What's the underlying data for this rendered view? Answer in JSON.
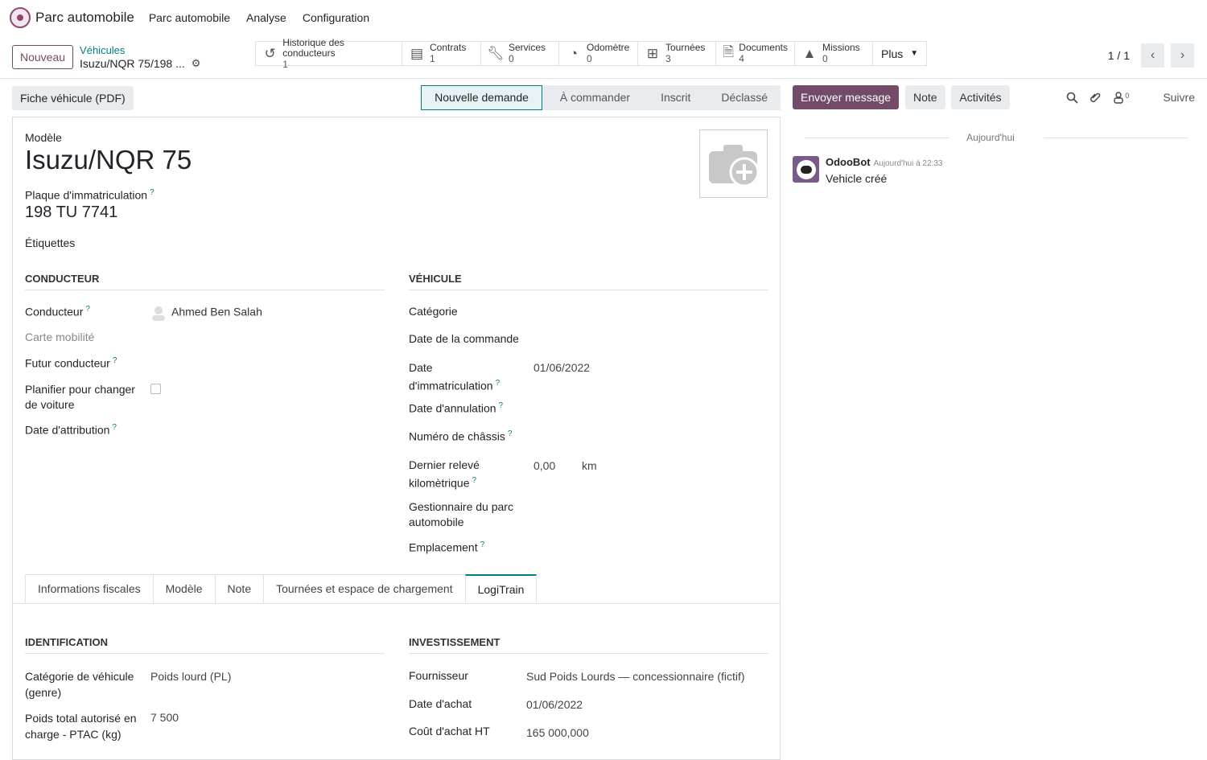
{
  "topnav": {
    "app_name": "Parc automobile",
    "menu": [
      "Parc automobile",
      "Analyse",
      "Configuration"
    ]
  },
  "control": {
    "new_label": "Nouveau",
    "breadcrumb_parent": "Véhicules",
    "breadcrumb_current": "Isuzu/NQR 75/198 ...",
    "smart_buttons": [
      {
        "label": "Historique des conducteurs",
        "count": "1",
        "icon": "history-icon"
      },
      {
        "label": "Contrats",
        "count": "1",
        "icon": "book-icon"
      },
      {
        "label": "Services",
        "count": "0",
        "icon": "wrench-icon"
      },
      {
        "label": "Odomètre",
        "count": "0",
        "icon": "tachometer-icon"
      },
      {
        "label": "Tournées",
        "count": "3",
        "icon": "map-icon"
      },
      {
        "label": "Documents",
        "count": "4",
        "icon": "document-icon"
      },
      {
        "label": "Missions",
        "count": "0",
        "icon": "road-icon"
      }
    ],
    "more_label": "Plus",
    "pager": "1 / 1"
  },
  "status": {
    "pdf_label": "Fiche véhicule (PDF)",
    "stages": [
      "Nouvelle demande",
      "À commander",
      "Inscrit",
      "Déclassé"
    ],
    "active_stage": "Nouvelle demande"
  },
  "form": {
    "model_label": "Modèle",
    "model_value": "Isuzu/NQR 75",
    "plate_label": "Plaque d'immatriculation",
    "plate_value": "198 TU 7741",
    "tags_label": "Étiquettes",
    "driver_section": "CONDUCTEUR",
    "vehicle_section": "VÉHICULE",
    "driver_label": "Conducteur",
    "driver_value": "Ahmed Ben Salah",
    "mobility_card_label": "Carte mobilité",
    "future_driver_label": "Futur conducteur",
    "plan_change_label_1": "Planifier pour changer",
    "plan_change_label_2": "de voiture",
    "assignment_date_label": "Date d'attribution",
    "category_label": "Catégorie",
    "order_date_label": "Date de la commande",
    "registration_date_label_1": "Date",
    "registration_date_label_2": "d'immatriculation",
    "registration_date_value": "01/06/2022",
    "cancel_date_label": "Date d'annulation",
    "chassis_label": "Numéro de châssis",
    "odometer_label_1": "Dernier relevé",
    "odometer_label_2": "kilomètrique",
    "odometer_value": "0,00",
    "odometer_unit": "km",
    "manager_label_1": "Gestionnaire du parc",
    "manager_label_2": "automobile",
    "location_label": "Emplacement"
  },
  "tabs": [
    "Informations fiscales",
    "Modèle",
    "Note",
    "Tournées et espace de chargement",
    "LogiTrain"
  ],
  "active_tab": "LogiTrain",
  "logitrain": {
    "identification_section": "IDENTIFICATION",
    "investment_section": "INVESTISSEMENT",
    "vehicle_category_label_1": "Catégorie de véhicule",
    "vehicle_category_label_2": "(genre)",
    "vehicle_category_value": "Poids lourd (PL)",
    "ptac_label_1": "Poids total autorisé en",
    "ptac_label_2": "charge - PTAC (kg)",
    "ptac_value": "7 500",
    "supplier_label": "Fournisseur",
    "supplier_value": "Sud Poids Lourds — concessionnaire (fictif)",
    "purchase_date_label": "Date d'achat",
    "purchase_date_value": "01/06/2022",
    "purchase_cost_label": "Coût d'achat HT",
    "purchase_cost_value": "165 000,000"
  },
  "chatter": {
    "send_label": "Envoyer message",
    "note_label": "Note",
    "activities_label": "Activités",
    "followers_count": "0",
    "follow_label": "Suivre",
    "today_label": "Aujourd'hui",
    "msg_author": "OdooBot",
    "msg_time": "Aujourd'hui à 22:33",
    "msg_body": "Vehicle créé"
  },
  "colors": {
    "brand": "#714b67",
    "accent": "#017e84"
  }
}
